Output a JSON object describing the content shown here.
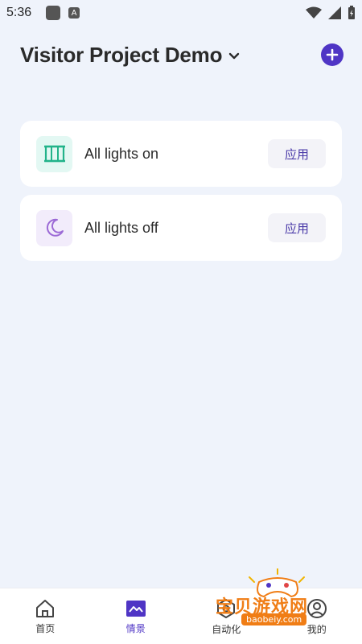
{
  "status_bar": {
    "time": "5:36"
  },
  "header": {
    "title": "Visitor Project Demo"
  },
  "scenes": [
    {
      "label": "All lights on",
      "icon": "lights-on-icon",
      "action": "应用",
      "accent": "#22b38a"
    },
    {
      "label": "All lights off",
      "icon": "moon-icon",
      "action": "应用",
      "accent": "#9c6ad6"
    }
  ],
  "nav": [
    {
      "label": "首页",
      "icon": "home-icon"
    },
    {
      "label": "情景",
      "icon": "scene-icon"
    },
    {
      "label": "自动化",
      "icon": "automation-icon"
    },
    {
      "label": "我的",
      "icon": "profile-icon"
    }
  ],
  "watermark": {
    "text": "宝贝游戏网",
    "url": "baobeiy.com"
  },
  "colors": {
    "accent": "#4f35c5",
    "background": "#eff3fb"
  }
}
